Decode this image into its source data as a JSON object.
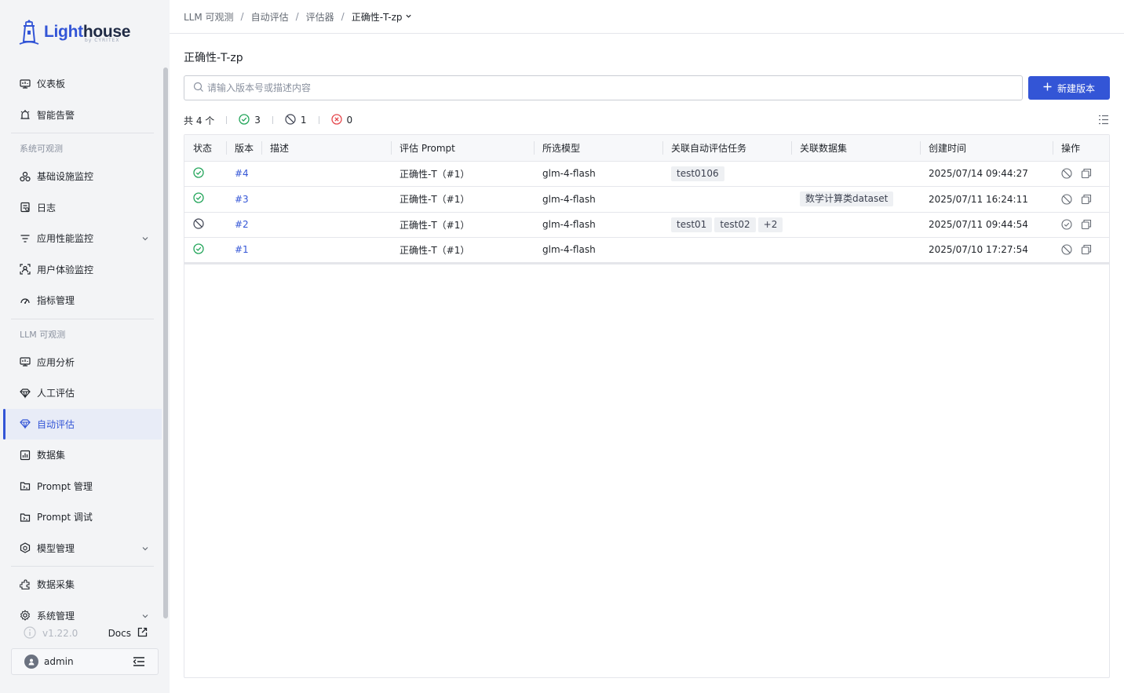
{
  "app": {
    "logo_text_a": "Light",
    "logo_text_b": "house",
    "logo_sub": "by CYRITEX"
  },
  "sidebar": {
    "items_top": [
      {
        "label": "仪表板",
        "icon": "dashboard-icon"
      },
      {
        "label": "智能告警",
        "icon": "alert-icon"
      }
    ],
    "section_system": "系统可观测",
    "items_system": [
      {
        "label": "基础设施监控",
        "icon": "infrastructure-icon"
      },
      {
        "label": "日志",
        "icon": "log-icon"
      },
      {
        "label": "应用性能监控",
        "icon": "apm-icon",
        "expandable": true
      },
      {
        "label": "用户体验监控",
        "icon": "user-experience-icon"
      },
      {
        "label": "指标管理",
        "icon": "metrics-icon"
      }
    ],
    "section_llm": "LLM 可观测",
    "items_llm": [
      {
        "label": "应用分析",
        "icon": "app-analysis-icon"
      },
      {
        "label": "人工评估",
        "icon": "human-eval-icon"
      },
      {
        "label": "自动评估",
        "icon": "auto-eval-icon",
        "active": true
      },
      {
        "label": "数据集",
        "icon": "dataset-icon"
      },
      {
        "label": "Prompt 管理",
        "icon": "prompt-manage-icon"
      },
      {
        "label": "Prompt 调试",
        "icon": "prompt-debug-icon"
      },
      {
        "label": "模型管理",
        "icon": "model-manage-icon",
        "expandable": true
      }
    ],
    "items_bottom": [
      {
        "label": "数据采集",
        "icon": "data-collect-icon"
      },
      {
        "label": "系统管理",
        "icon": "system-settings-icon",
        "expandable": true
      }
    ],
    "version": "v1.22.0",
    "docs_label": "Docs",
    "user_name": "admin"
  },
  "breadcrumb": {
    "items": [
      "LLM 可观测",
      "自动评估",
      "评估器"
    ],
    "separator": "/",
    "current": "正确性-T-zp"
  },
  "page": {
    "title": "正确性-T-zp",
    "search_placeholder": "请输入版本号或描述内容",
    "search_value": "",
    "new_button": "新建版本"
  },
  "stats": {
    "total": "共 4 个",
    "success": "3",
    "disabled": "1",
    "failed": "0"
  },
  "table": {
    "columns": [
      "状态",
      "版本",
      "描述",
      "评估 Prompt",
      "所选模型",
      "关联自动评估任务",
      "关联数据集",
      "创建时间",
      "操作"
    ],
    "rows": [
      {
        "status": "success",
        "version": "#4",
        "desc": "",
        "prompt": "正确性-T（#1）",
        "model": "glm-4-flash",
        "tasks": [
          "test0106"
        ],
        "datasets": [],
        "created": "2025/07/14 09:44:27",
        "toggle_action": "disable"
      },
      {
        "status": "success",
        "version": "#3",
        "desc": "",
        "prompt": "正确性-T（#1）",
        "model": "glm-4-flash",
        "tasks": [],
        "datasets": [
          "数学计算类dataset"
        ],
        "created": "2025/07/11 16:24:11",
        "toggle_action": "disable"
      },
      {
        "status": "disabled",
        "version": "#2",
        "desc": "",
        "prompt": "正确性-T（#1）",
        "model": "glm-4-flash",
        "tasks": [
          "test01",
          "test02",
          "+2"
        ],
        "datasets": [],
        "created": "2025/07/11 09:44:54",
        "toggle_action": "enable"
      },
      {
        "status": "success",
        "version": "#1",
        "desc": "",
        "prompt": "正确性-T（#1）",
        "model": "glm-4-flash",
        "tasks": [],
        "datasets": [],
        "created": "2025/07/10 17:27:54",
        "toggle_action": "disable"
      }
    ]
  },
  "colors": {
    "accent": "#3355d6",
    "success": "#23a55a",
    "danger": "#e5484d",
    "muted": "#646a73"
  }
}
